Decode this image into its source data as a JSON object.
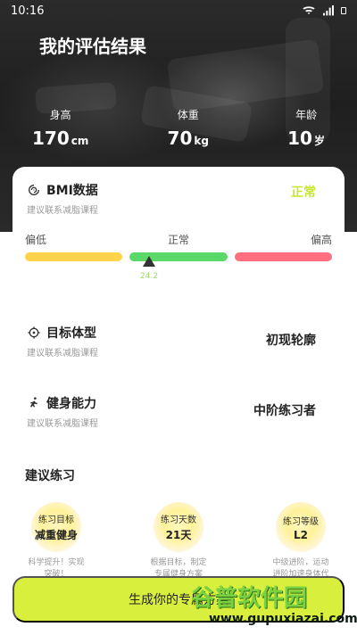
{
  "status_bar": {
    "time": "10:16",
    "icons": [
      "wifi-icon",
      "signal-icon",
      "battery-icon"
    ]
  },
  "hero": {
    "title": "我的评估结果",
    "metrics": [
      {
        "label": "身高",
        "value": "170",
        "unit": "cm"
      },
      {
        "label": "体重",
        "value": "70",
        "unit": "kg"
      },
      {
        "label": "年龄",
        "value": "10",
        "unit": "岁"
      }
    ]
  },
  "bmi": {
    "title": "BMI数据",
    "subtitle": "建议联系减脂课程",
    "status": "正常",
    "categories": [
      "偏低",
      "正常",
      "偏高"
    ],
    "value": "24.2",
    "colors": {
      "low": "#ffd44a",
      "normal": "#5bd86a",
      "high": "#ff6f7e",
      "status": "#c6e72f"
    }
  },
  "body_type": {
    "title": "目标体型",
    "subtitle": "建议联系减脂课程",
    "value": "初现轮廓"
  },
  "fitness_ability": {
    "title": "健身能力",
    "subtitle": "建议联系减脂课程",
    "value": "中阶练习者"
  },
  "suggest": {
    "title": "建议练习",
    "items": [
      {
        "label": "练习目标",
        "value": "减重健身",
        "desc": "科学提升！实现突破！"
      },
      {
        "label": "练习天数",
        "value": "21天",
        "desc": "根据目标，制定专属健身方案"
      },
      {
        "label": "练习等级",
        "value": "L2",
        "desc": "中级进阶，运动进阶加速身体代谢"
      }
    ]
  },
  "cta": {
    "label": "生成你的专属方案"
  },
  "watermark": {
    "brand": "谷普软件园",
    "url": "www.gupuxiazai.com"
  }
}
